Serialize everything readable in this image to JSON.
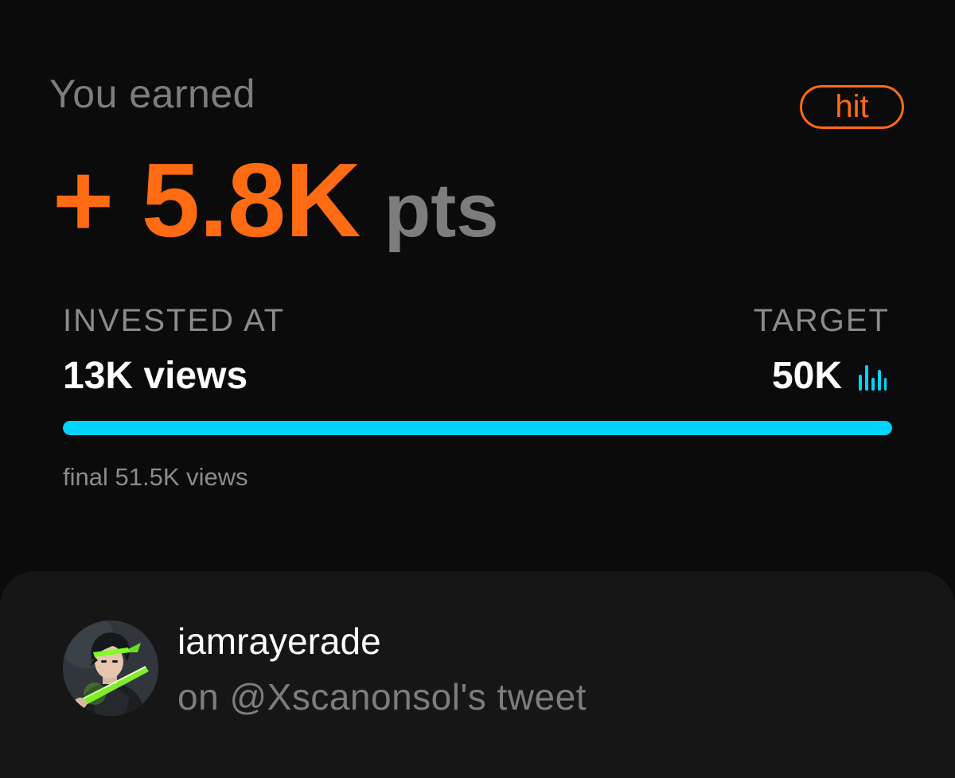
{
  "earned": {
    "label": "You earned",
    "amount": "+ 5.8K",
    "unit": "pts",
    "status_badge": "hit"
  },
  "progress": {
    "invested_label": "INVESTED AT",
    "invested_value": "13K views",
    "target_label": "TARGET",
    "target_value": "50K",
    "target_icon": "bar-chart-icon",
    "fill_percent": 100,
    "final_text": "final 51.5K views"
  },
  "user": {
    "username": "iamrayerade",
    "context": "on @Xscanonsol's tweet",
    "avatar_icon": "avatar-illustration"
  },
  "colors": {
    "accent_orange": "#ff6b12",
    "accent_cyan": "#00d4ff",
    "background": "#0b0b0b",
    "card_background": "#161616",
    "muted_text": "#7d7d7d"
  }
}
